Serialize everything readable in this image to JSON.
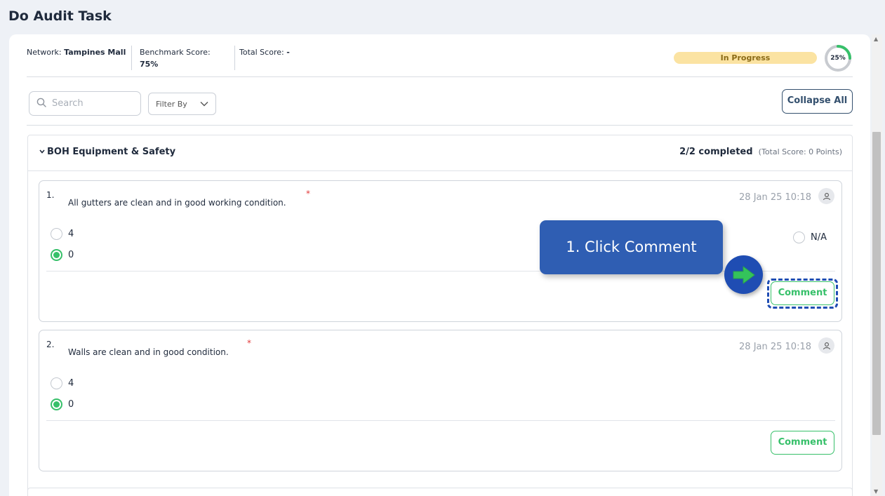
{
  "page": {
    "title": "Do Audit Task"
  },
  "meta": {
    "network_label": "Network:",
    "network_value": "Tampines Mall",
    "benchmark_label": "Benchmark Score:",
    "benchmark_value": "75%",
    "total_label": "Total Score:",
    "total_value": "-"
  },
  "status": {
    "label": "In Progress",
    "progress_percent": 25,
    "progress_text": "25%",
    "accent_color": "#37c06a",
    "pill_color": "#fbe3a2"
  },
  "toolbar": {
    "search_placeholder": "Search",
    "filter_label": "Filter By",
    "collapse_label": "Collapse All"
  },
  "section": {
    "title": "BOH Equipment & Safety",
    "completed": "2/2 completed",
    "total_score": "(Total Score: 0 Points)"
  },
  "questions": [
    {
      "number": "1.",
      "text": "All gutters are clean and in good working condition.",
      "required_mark": "*",
      "date": "28 Jan 25 10:18",
      "options": [
        {
          "label": "4",
          "selected": false
        },
        {
          "label": "0",
          "selected": true
        }
      ],
      "na_label": "N/A",
      "comment_label": "Comment"
    },
    {
      "number": "2.",
      "text": "Walls are clean and in good condition.",
      "required_mark": "*",
      "date": "28 Jan 25 10:18",
      "options": [
        {
          "label": "4",
          "selected": false
        },
        {
          "label": "0",
          "selected": true
        }
      ],
      "comment_label": "Comment"
    }
  ],
  "tutorial": {
    "callout_text": "1. Click Comment",
    "callout_color": "#2f5eb3"
  },
  "icons": {
    "search": "search-icon",
    "chevron": "chevron-down-icon",
    "user": "user-icon",
    "arrow": "arrow-right-icon"
  }
}
